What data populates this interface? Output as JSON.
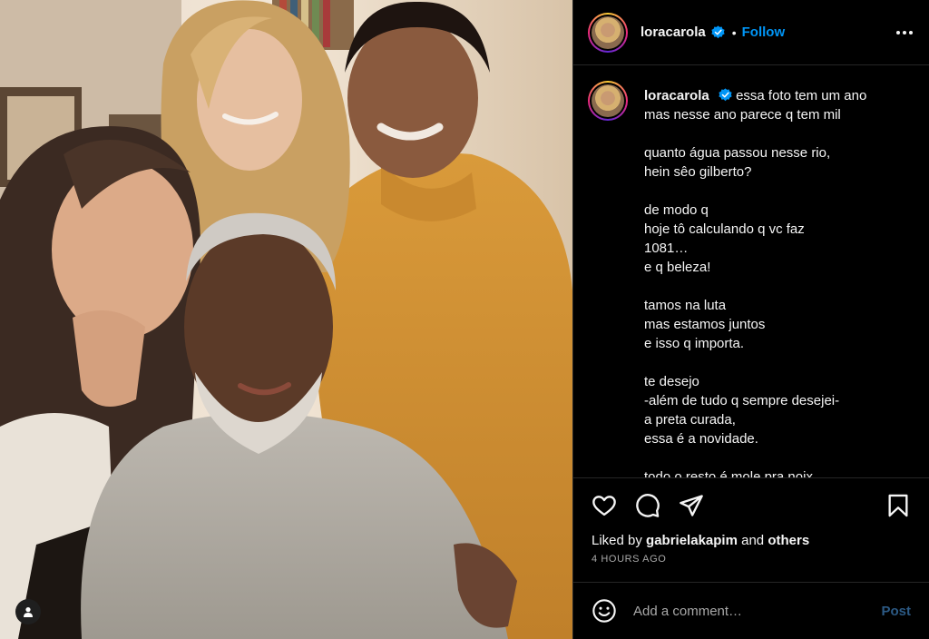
{
  "post": {
    "image_alt": "Four people posing together: a woman with long dark hair, a blonde woman, a woman in a mustard sweater and an older man with a white beard in a grey sweater",
    "user_tag_icon": "user-icon"
  },
  "header": {
    "username": "loracarola",
    "verified_icon": "verified-badge-icon",
    "separator": "•",
    "follow_label": "Follow",
    "more_icon": "more-options-icon"
  },
  "caption": {
    "username": "loracarola",
    "text": "essa foto tem um ano\nmas nesse ano parece q tem mil\n\nquanto água passou nesse rio,\nhein sêo gilberto?\n\nde modo q\nhoje tô calculando q vc faz\n1081…\ne q beleza!\n\ntamos na luta\nmas estamos juntos\ne isso q importa.\n\nte desejo\n-além de tudo q sempre desejei-\na preta curada,\nessa é a novidade.\n\ntodo o resto é mole pra noix"
  },
  "actions": {
    "like_icon": "heart-icon",
    "comment_icon": "comment-bubble-icon",
    "share_icon": "paper-plane-icon",
    "save_icon": "bookmark-icon"
  },
  "likes": {
    "prefix": "Liked by",
    "user": "gabrielakapim",
    "conjunction": "and",
    "others": "others"
  },
  "timestamp": "4 HOURS AGO",
  "comment_box": {
    "emoji_icon": "smiley-icon",
    "placeholder": "Add a comment…",
    "value": "",
    "post_label": "Post"
  },
  "colors": {
    "background": "#000000",
    "divider": "#262626",
    "text": "#f5f5f5",
    "secondary_text": "#a8a8a8",
    "follow_blue": "#0095f6",
    "post_disabled": "#2c5a85"
  }
}
